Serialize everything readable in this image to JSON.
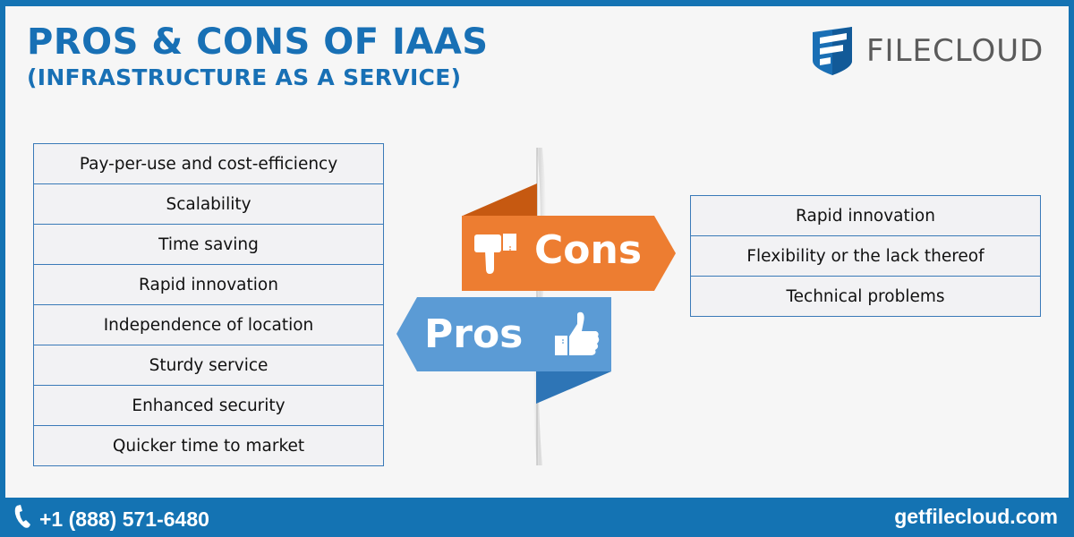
{
  "title": {
    "line1": "PROS & CONS OF IAAS",
    "line2": "(INFRASTRUCTURE AS A SERVICE)"
  },
  "logo": {
    "icon": "filecloud-shield-icon",
    "text": "FILECLOUD"
  },
  "pros": {
    "label": "Pros",
    "icon": "thumbs-up-icon",
    "items": [
      "Pay-per-use and cost-efficiency",
      "Scalability",
      "Time saving",
      "Rapid innovation",
      "Independence of location",
      "Sturdy service",
      "Enhanced security",
      "Quicker time to market"
    ]
  },
  "cons": {
    "label": "Cons",
    "icon": "thumbs-down-icon",
    "items": [
      "Rapid innovation",
      "Flexibility or the lack thereof",
      "Technical problems"
    ]
  },
  "footer": {
    "phone_icon": "phone-icon",
    "phone": "+1 (888) 571-6480",
    "url": "getfilecloud.com"
  },
  "colors": {
    "brand_blue": "#1473b3",
    "title_blue": "#1870b5",
    "cons_orange": "#ed7d31",
    "cons_orange_dark": "#c65911",
    "pros_blue": "#5b9bd5",
    "pros_blue_dark": "#2e75b6",
    "background": "#f6f6f6"
  }
}
